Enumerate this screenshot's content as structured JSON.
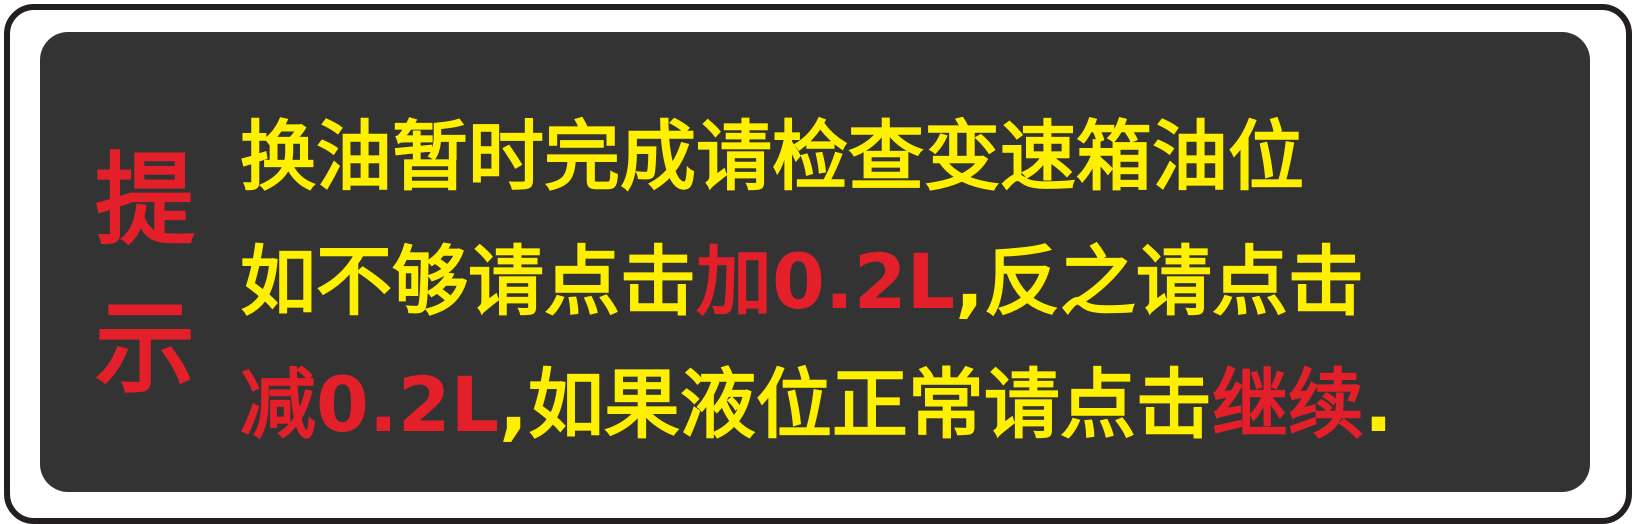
{
  "colors": {
    "background": "#333333",
    "text": "#fff000",
    "highlight": "#e3202a",
    "frame": "#231f20"
  },
  "side_label": [
    "提",
    "示"
  ],
  "lines": [
    [
      "换油暂时完成请检查变速箱油位"
    ],
    [
      "如不够请点击",
      "加0.2L",
      ",反之请点击"
    ],
    [
      "减0.2L",
      ",如果液位正常请点击",
      "继续",
      "."
    ]
  ]
}
